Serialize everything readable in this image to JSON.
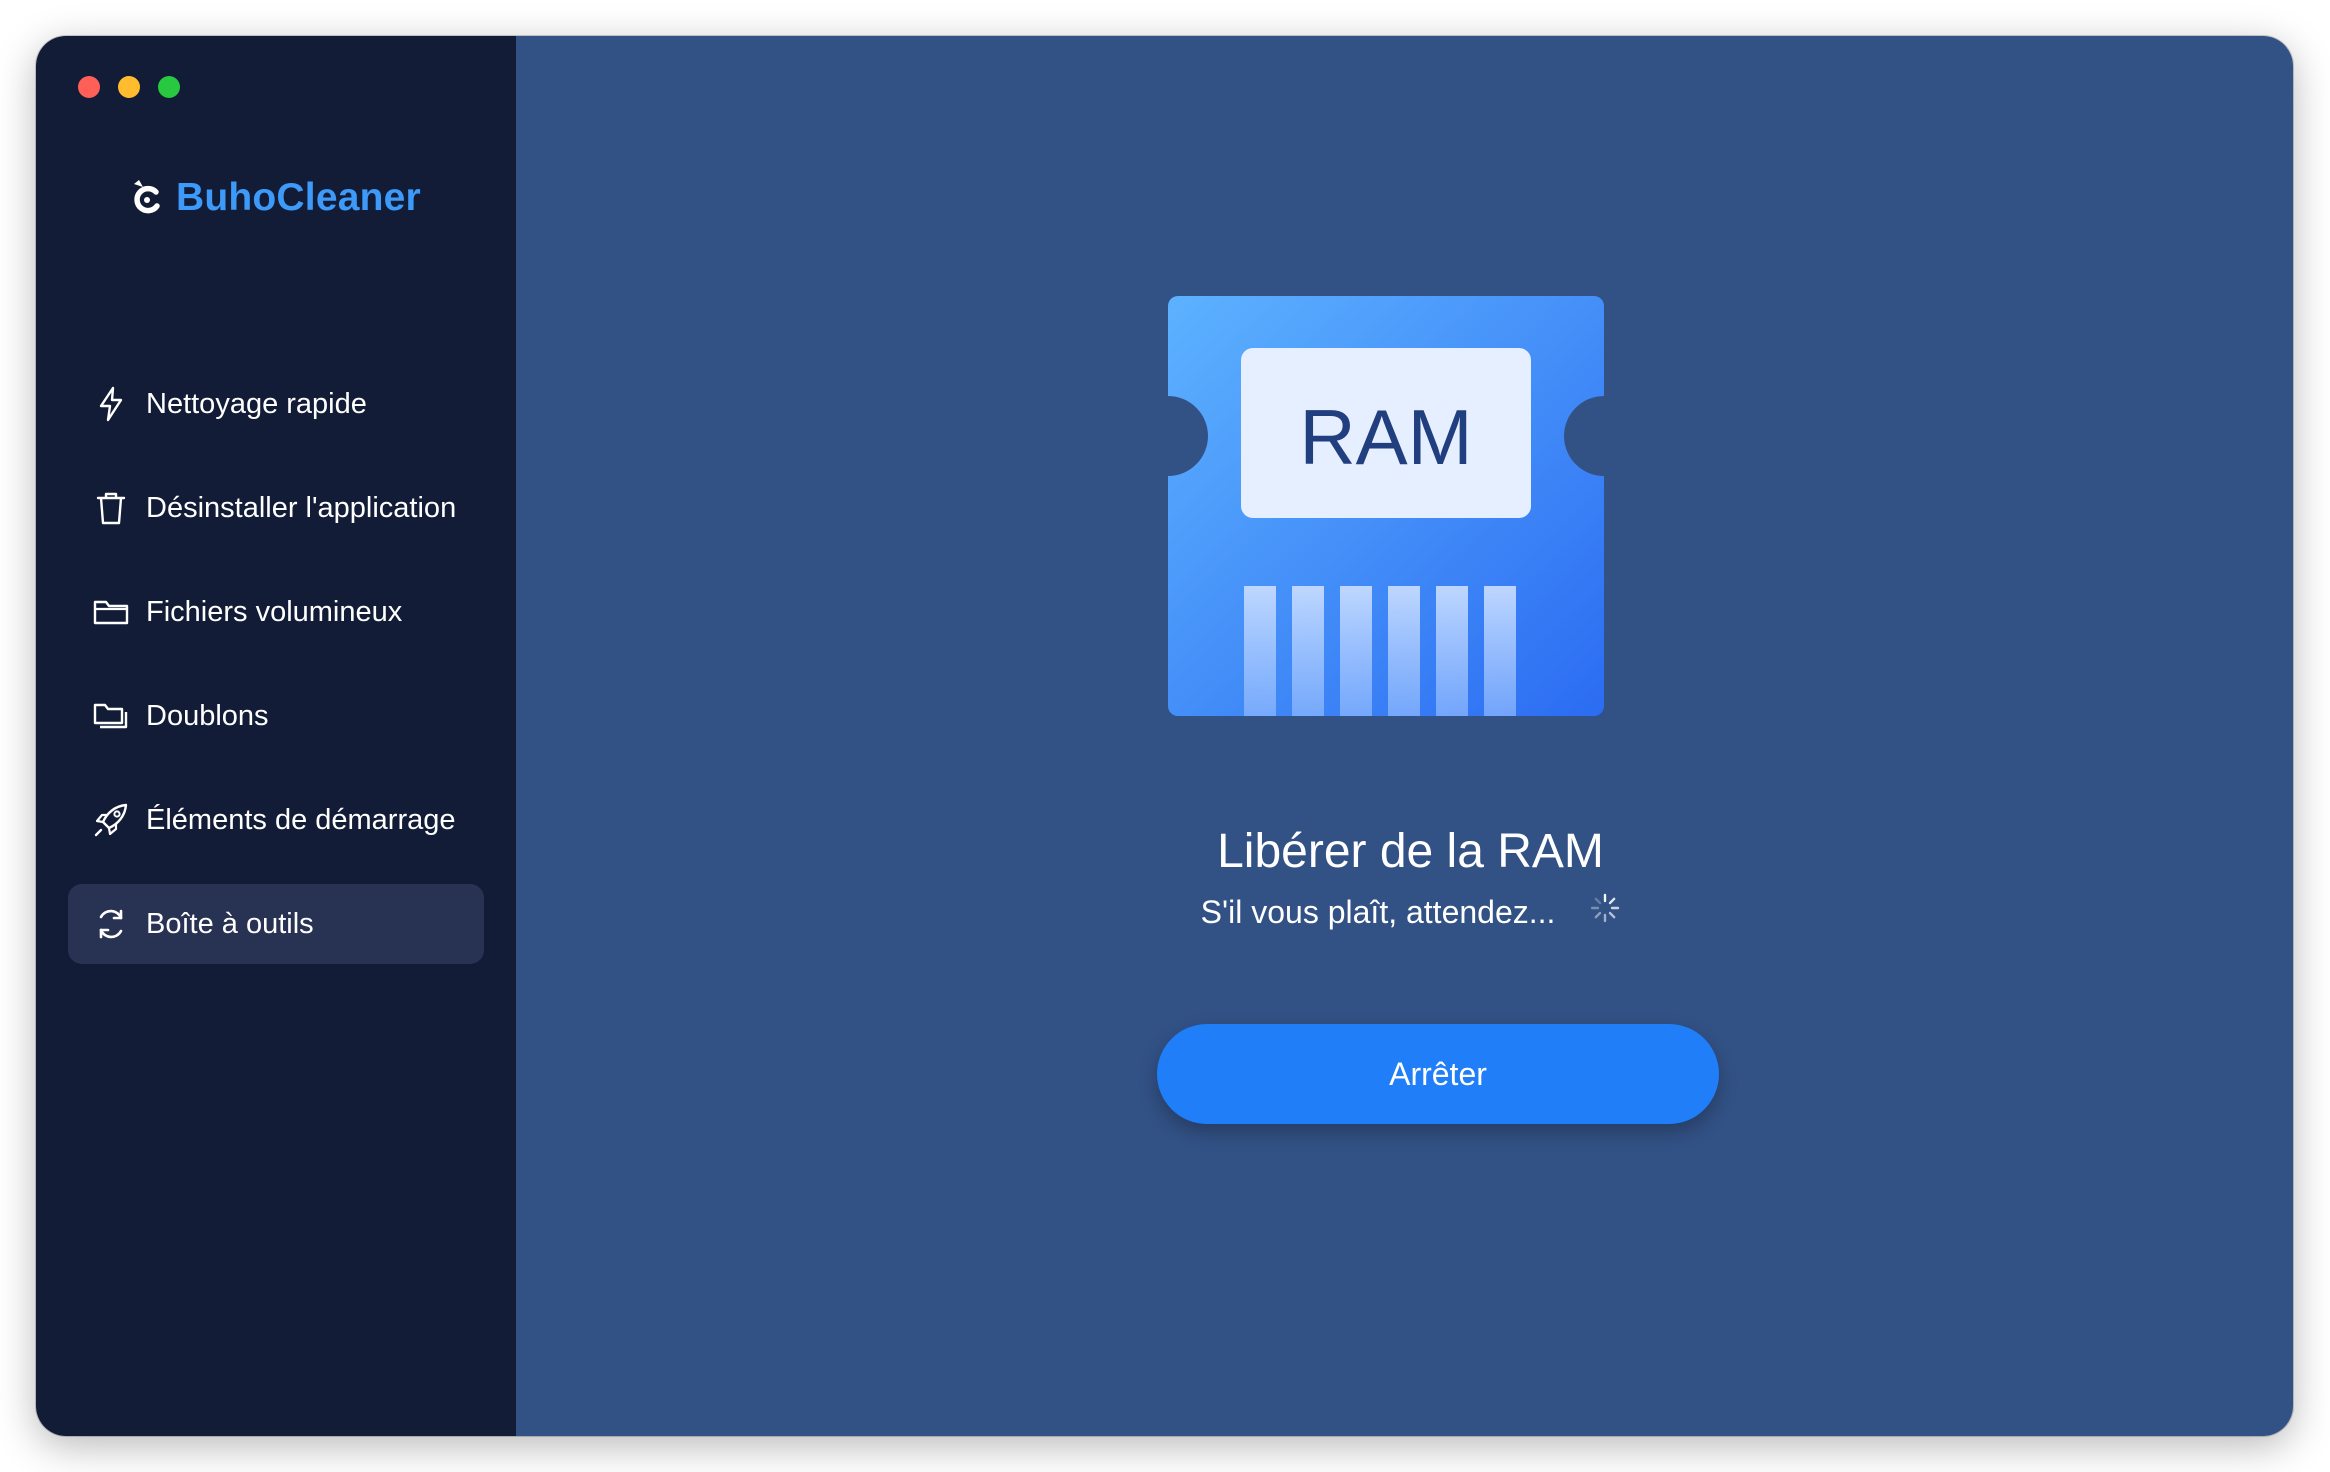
{
  "app": {
    "name": "BuhoCleaner"
  },
  "sidebar": {
    "items": [
      {
        "label": "Nettoyage rapide",
        "icon": "lightning-icon"
      },
      {
        "label": "Désinstaller l'application",
        "icon": "trash-icon"
      },
      {
        "label": "Fichiers volumineux",
        "icon": "folder-icon"
      },
      {
        "label": "Doublons",
        "icon": "duplicate-folders-icon"
      },
      {
        "label": "Éléments de démarrage",
        "icon": "rocket-icon"
      },
      {
        "label": "Boîte à outils",
        "icon": "refresh-cycle-icon",
        "active": true
      }
    ]
  },
  "main": {
    "graphic_label": "RAM",
    "title": "Libérer de la RAM",
    "status": "S'il vous plaît, attendez...",
    "stop_button": "Arrêter"
  },
  "colors": {
    "sidebar_bg": "#131c36",
    "main_bg": "#325185",
    "brand_blue": "#3d9af8",
    "button_blue": "#1f7ef8",
    "active_item_bg": "#283252"
  }
}
